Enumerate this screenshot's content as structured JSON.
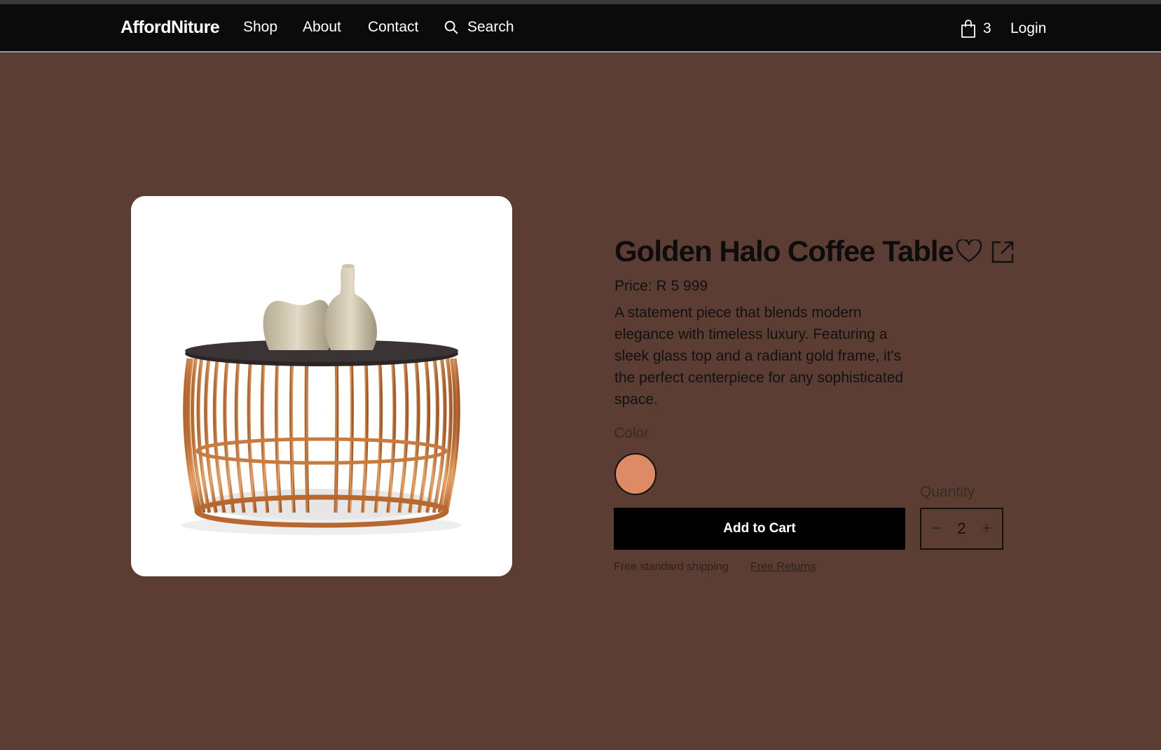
{
  "nav": {
    "brand": "AffordNiture",
    "links": [
      {
        "label": "Shop"
      },
      {
        "label": "About"
      },
      {
        "label": "Contact"
      }
    ],
    "search_label": "Search",
    "cart_count": "3",
    "login_label": "Login"
  },
  "product": {
    "title": "Golden Halo Coffee Table",
    "price": "Price: R 5 999",
    "description": "A statement piece that blends modern elegance with timeless luxury. Featuring a sleek glass top and a radiant gold frame, it's the perfect centerpiece for any sophisticated space.",
    "color_label": "Color",
    "color_swatch": "#de8a65",
    "quantity_label": "Quantity",
    "quantity_value": "2",
    "add_to_cart_label": "Add to Cart",
    "shipping_text": "Free standard shipping",
    "returns_link": "Free Returns"
  },
  "icons": {
    "search": "search-icon",
    "cart": "shopping-bag-icon",
    "wishlist": "heart-icon",
    "share": "external-share-icon",
    "decrease": "minus-icon",
    "increase": "plus-icon"
  },
  "colors": {
    "page_background": "#5c3d33",
    "navbar": "#0b0b0b",
    "button": "#000000"
  }
}
